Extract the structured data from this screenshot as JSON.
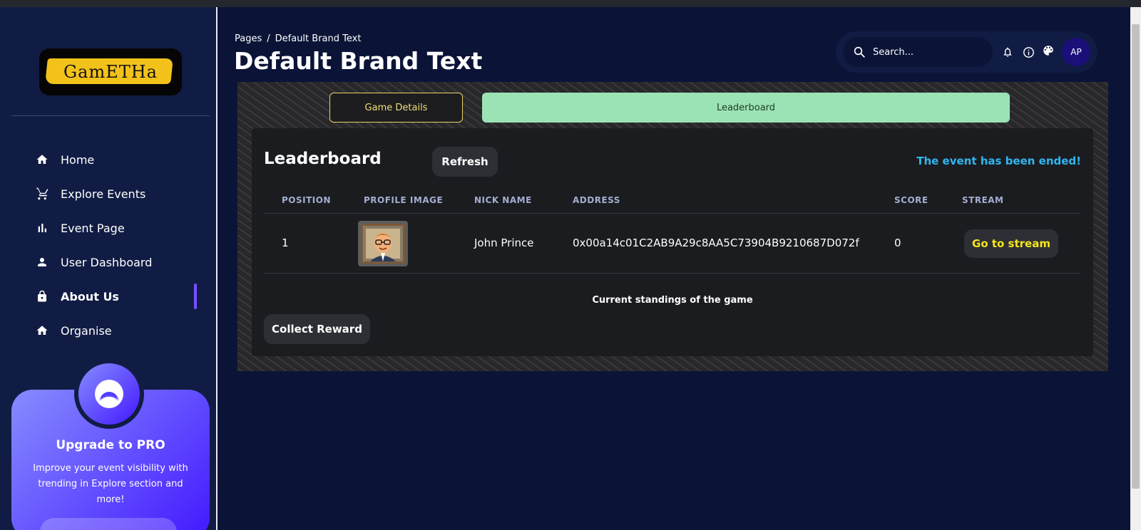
{
  "sidebar": {
    "logo_text": "GamETHa",
    "items": [
      {
        "label": "Home",
        "icon": "home-icon"
      },
      {
        "label": "Explore Events",
        "icon": "cart-icon"
      },
      {
        "label": "Event Page",
        "icon": "bar-chart-icon"
      },
      {
        "label": "User Dashboard",
        "icon": "person-icon"
      },
      {
        "label": "About Us",
        "icon": "lock-icon",
        "active": true
      },
      {
        "label": "Organise",
        "icon": "home-icon"
      }
    ],
    "pro": {
      "title": "Upgrade to PRO",
      "description": "Improve your event visibility with trending in Explore section and more!"
    }
  },
  "header": {
    "breadcrumb_root": "Pages",
    "breadcrumb_separator": "/",
    "breadcrumb_current": "Default Brand Text",
    "title": "Default Brand Text",
    "search_placeholder": "Search...",
    "avatar_initials": "AP"
  },
  "tabs": {
    "game_details": "Game Details",
    "leaderboard": "Leaderboard"
  },
  "leaderboard": {
    "title": "Leaderboard",
    "refresh_label": "Refresh",
    "status_text": "The event has been ended!",
    "columns": [
      "POSITION",
      "PROFILE IMAGE",
      "NICK NAME",
      "ADDRESS",
      "SCORE",
      "STREAM"
    ],
    "rows": [
      {
        "position": "1",
        "nick_name": "John Prince",
        "address": "0x00a14c01C2AB9A29c8AA5C73904B9210687D072f",
        "score": "0",
        "stream_label": "Go to stream"
      }
    ],
    "caption": "Current standings of the game",
    "collect_label": "Collect Reward"
  },
  "colors": {
    "background": "#0b1437",
    "sidebar": "#111c44",
    "accent": "#7551ff",
    "tab_active": "#9be3b5",
    "status": "#2fb7f0",
    "stream_text": "#f5e61c"
  }
}
